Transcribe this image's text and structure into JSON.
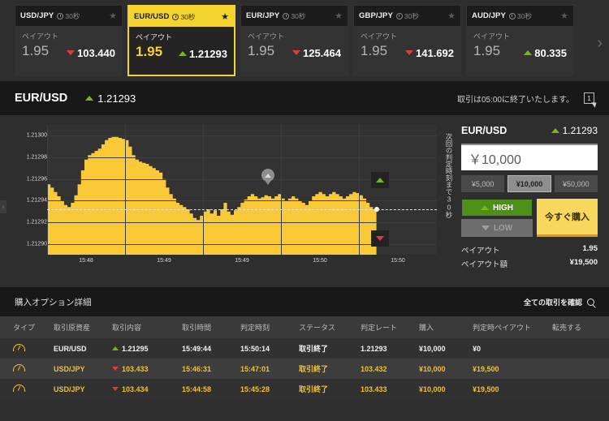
{
  "asset_bar": {
    "cards": [
      {
        "pair": "USD/JPY",
        "duration": "30秒",
        "payout_label": "ペイアウト",
        "payout": "1.95",
        "price": "103.440",
        "dir": "down",
        "active": false
      },
      {
        "pair": "EUR/USD",
        "duration": "30秒",
        "payout_label": "ペイアウト",
        "payout": "1.95",
        "price": "1.21293",
        "dir": "up",
        "active": true
      },
      {
        "pair": "EUR/JPY",
        "duration": "30秒",
        "payout_label": "ペイアウト",
        "payout": "1.95",
        "price": "125.464",
        "dir": "down",
        "active": false
      },
      {
        "pair": "GBP/JPY",
        "duration": "30秒",
        "payout_label": "ペイアウト",
        "payout": "1.95",
        "price": "141.692",
        "dir": "down",
        "active": false
      },
      {
        "pair": "AUD/JPY",
        "duration": "30秒",
        "payout_label": "ペイアウト",
        "payout": "1.95",
        "price": "80.335",
        "dir": "up",
        "active": false
      }
    ],
    "next_arrow": "›"
  },
  "quote_bar": {
    "pair": "EUR/USD",
    "price": "1.21293",
    "dir": "up",
    "note": "取引は05:00に終了いたします。",
    "note_icon": "1"
  },
  "chart": {
    "side_tab": "›",
    "vertical_label": "次回の判定時刻まで30秒",
    "marker_up": "▲",
    "marker_down": "▼"
  },
  "chart_data": {
    "type": "area",
    "title": "EUR/USD",
    "xlabel": "",
    "ylabel": "",
    "ytick_labels": [
      "1.21300",
      "1.21298",
      "1.21296",
      "1.21294",
      "1.21292",
      "1.21290"
    ],
    "ylim": [
      1.21289,
      1.21301
    ],
    "xtick_labels": [
      "15:48",
      "15:49",
      "15:49",
      "15:50",
      "15:50"
    ],
    "strike_price": 1.212932,
    "last_price": 1.21293,
    "grid": true,
    "legend": "none",
    "series": [
      {
        "name": "EUR/USD",
        "values": [
          1.212955,
          1.212952,
          1.212948,
          1.212944,
          1.21294,
          1.212936,
          1.212934,
          1.212938,
          1.212945,
          1.212955,
          1.212968,
          1.212978,
          1.212982,
          1.212984,
          1.212986,
          1.212988,
          1.212992,
          1.212996,
          1.212998,
          1.212999,
          1.212999,
          1.212998,
          1.212997,
          1.212996,
          1.21299,
          1.212982,
          1.212978,
          1.212976,
          1.212975,
          1.212974,
          1.212972,
          1.21297,
          1.212968,
          1.212966,
          1.21296,
          1.212952,
          1.212946,
          1.212942,
          1.212938,
          1.212936,
          1.212934,
          1.212932,
          1.212928,
          1.212924,
          1.212922,
          1.212926,
          1.21293,
          1.212932,
          1.212928,
          1.212931,
          1.212926,
          1.212932,
          1.212938,
          1.21293,
          1.212927,
          1.212931,
          1.212934,
          1.212938,
          1.212941,
          1.212944,
          1.212946,
          1.212944,
          1.212942,
          1.212943,
          1.212945,
          1.212944,
          1.212942,
          1.212944,
          1.212946,
          1.212942,
          1.21294,
          1.212942,
          1.212944,
          1.212942,
          1.21294,
          1.212938,
          1.212936,
          1.21294,
          1.212944,
          1.212946,
          1.212948,
          1.212946,
          1.212944,
          1.212946,
          1.212948,
          1.212946,
          1.212944,
          1.212942,
          1.212944,
          1.212946,
          1.212948,
          1.212947,
          1.212945,
          1.212942,
          1.212938,
          1.212934,
          1.212932,
          1.212932
        ]
      }
    ]
  },
  "trade_panel": {
    "pair": "EUR/USD",
    "price": "1.21293",
    "dir": "up",
    "amount_value": "￥10,000",
    "amount_placeholder": "￥10,000",
    "chips": [
      {
        "label": "¥5,000",
        "selected": false
      },
      {
        "label": "¥10,000",
        "selected": true
      },
      {
        "label": "¥50,000",
        "selected": false
      }
    ],
    "high_label": "HIGH",
    "low_label": "LOW",
    "buy_label": "今すぐ購入",
    "stats": [
      {
        "label": "ペイアウト",
        "value": "1.95"
      },
      {
        "label": "ペイアウト額",
        "value": "¥19,500"
      }
    ]
  },
  "detail_bar": {
    "title": "購入オプション詳細",
    "all_trades_label": "全ての取引を確認"
  },
  "table": {
    "headers": [
      "タイプ",
      "取引原資産",
      "取引内容",
      "取引時間",
      "判定時刻",
      "ステータス",
      "判定レート",
      "購入",
      "判定時ペイアウト",
      "転売する"
    ],
    "rows": [
      {
        "gold": false,
        "type_icon": "gauge-icon",
        "asset": "EUR/USD",
        "dir": "up",
        "rate": "1.21295",
        "trade_time": "15:49:44",
        "expiry_time": "15:50:14",
        "status": "取引終了",
        "judge_rate": "1.21293",
        "purchase": "¥10,000",
        "payout": "¥0",
        "resell": ""
      },
      {
        "gold": true,
        "type_icon": "gauge-icon",
        "asset": "USD/JPY",
        "dir": "down",
        "rate": "103.433",
        "trade_time": "15:46:31",
        "expiry_time": "15:47:01",
        "status": "取引終了",
        "judge_rate": "103.432",
        "purchase": "¥10,000",
        "payout": "¥19,500",
        "resell": ""
      },
      {
        "gold": true,
        "type_icon": "gauge-icon",
        "asset": "USD/JPY",
        "dir": "down",
        "rate": "103.434",
        "trade_time": "15:44:58",
        "expiry_time": "15:45:28",
        "status": "取引終了",
        "judge_rate": "103.433",
        "purchase": "¥10,000",
        "payout": "¥19,500",
        "resell": ""
      }
    ]
  }
}
